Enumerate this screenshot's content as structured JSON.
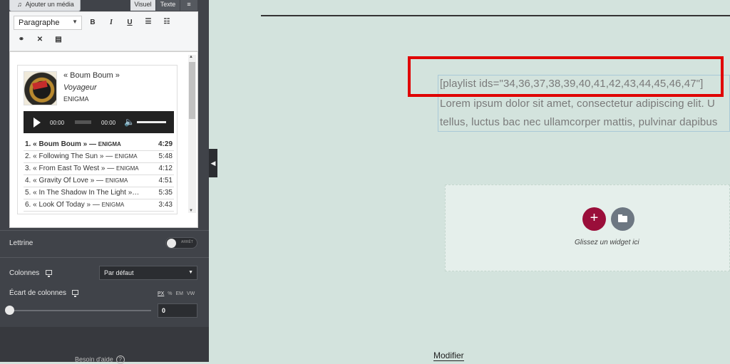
{
  "editor": {
    "add_media_label": "Ajouter un média",
    "tab_visual": "Visuel",
    "tab_text": "Texte",
    "format_select": "Paragraphe",
    "toolbar": {
      "bold": "B",
      "italic": "I",
      "underline": "U"
    },
    "playlist": {
      "current_track": "« Boum Boum »",
      "album": "Voyageur",
      "artist": "ENIGMA",
      "player": {
        "time_current": "00:00",
        "time_total": "00:00"
      },
      "tracks": [
        {
          "title": "1. « Boum Boum » — ",
          "artist": "ENIGMA",
          "duration": "4:29"
        },
        {
          "title": "2. « Following The Sun » — ",
          "artist": "ENIGMA",
          "duration": "5:48"
        },
        {
          "title": "3. « From East To West » — ",
          "artist": "ENIGMA",
          "duration": "4:12"
        },
        {
          "title": "4. « Gravity Of Love » — ",
          "artist": "ENIGMA",
          "duration": "4:51"
        },
        {
          "title": "5. « In The Shadow In The Light »…",
          "artist": "",
          "duration": "5:35"
        },
        {
          "title": "6. « Look Of Today » — ",
          "artist": "ENIGMA",
          "duration": "3:43"
        }
      ]
    }
  },
  "settings": {
    "dropcap_label": "Lettrine",
    "dropcap_toggle": "ARRÊT",
    "columns_label": "Colonnes",
    "columns_value": "Par défaut",
    "gap_label": "Écart de colonnes",
    "units": {
      "px": "PX",
      "pct": "%",
      "em": "EM",
      "vw": "VW"
    },
    "gap_value": "0",
    "help_label": "Besoin d'aide"
  },
  "canvas": {
    "shortcode": "[playlist ids=\"34,36,37,38,39,40,41,42,43,44,45,46,47\"]",
    "lorem_line1": "Lorem ipsum dolor sit amet, consectetur adipiscing elit. U",
    "lorem_line2": "tellus, luctus bac nec ullamcorper mattis, pulvinar dapibus",
    "drop_caption": "Glissez un widget ici",
    "modify_link": "Modifier"
  },
  "colors": {
    "panel_bg": "#404349",
    "canvas_bg": "#d3e3dd",
    "highlight": "#e00000",
    "add_button": "#9a0e3a"
  }
}
